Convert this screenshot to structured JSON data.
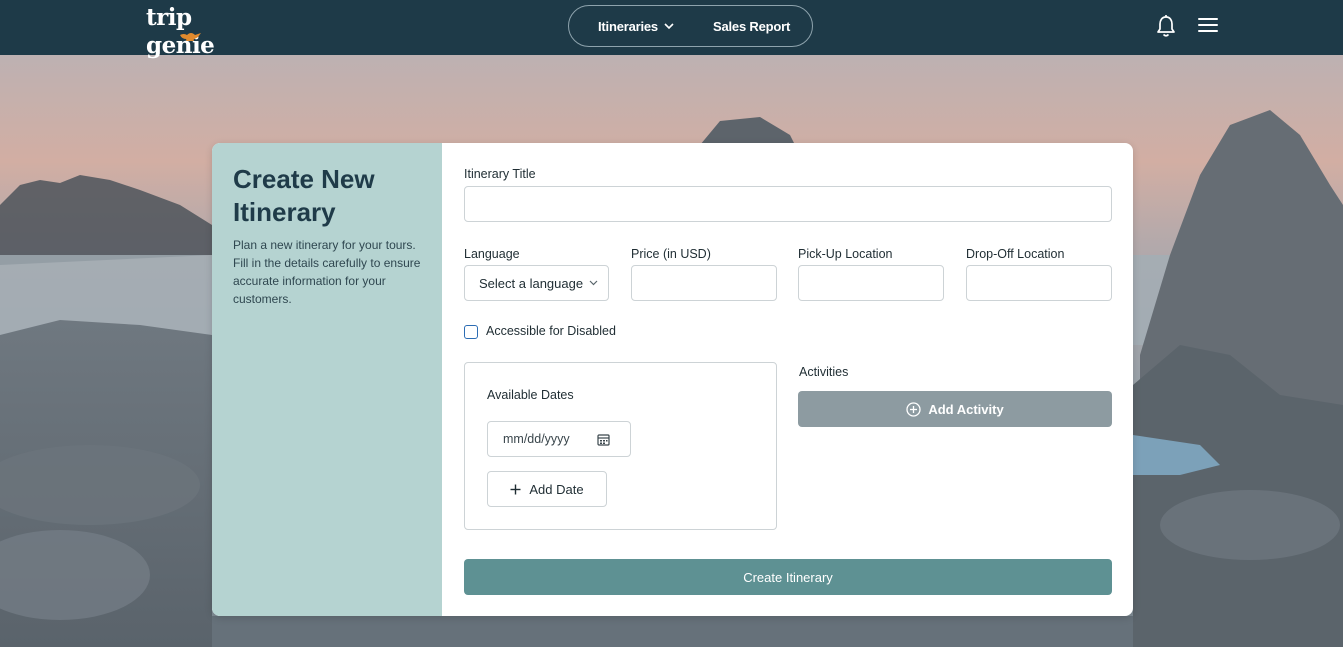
{
  "app": {
    "logo_text": "trip genie"
  },
  "nav": {
    "itineraries_label": "Itineraries",
    "sales_report_label": "Sales Report"
  },
  "side": {
    "title": "Create New Itinerary",
    "description": "Plan a new itinerary for your tours. Fill in the details carefully to ensure accurate information for your customers."
  },
  "form": {
    "title_label": "Itinerary Title",
    "title_value": "",
    "language_label": "Language",
    "language_placeholder": "Select a language",
    "price_label": "Price (in USD)",
    "price_value": "",
    "pickup_label": "Pick-Up Location",
    "pickup_value": "",
    "dropoff_label": "Drop-Off Location",
    "dropoff_value": "",
    "accessible_label": "Accessible for Disabled",
    "accessible_checked": false,
    "dates_label": "Available Dates",
    "date_placeholder": "mm/dd/yyyy",
    "add_date_label": "Add Date",
    "activities_label": "Activities",
    "add_activity_label": "Add Activity",
    "submit_label": "Create Itinerary"
  },
  "colors": {
    "header_bg": "#1e3a48",
    "side_panel_bg": "#b5d3d1",
    "primary_button": "#5e9193",
    "disabled_button": "#8d9ba1",
    "checkbox_border": "#2c6cb3"
  },
  "icons": {
    "logo_lamp": "genie-lamp-icon",
    "bell": "bell-icon",
    "menu": "hamburger-menu-icon",
    "dropdown": "chevron-down-icon",
    "calendar": "calendar-icon",
    "add": "plus-icon",
    "add_circle": "plus-circle-icon"
  }
}
